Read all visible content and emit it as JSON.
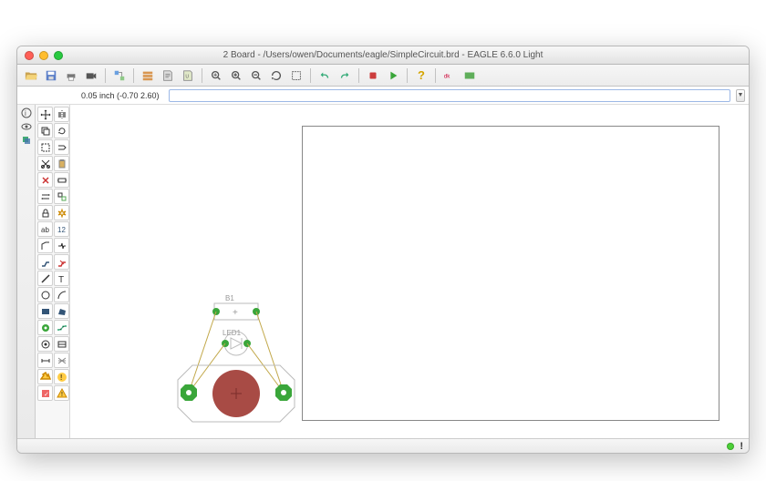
{
  "window": {
    "title": "2 Board - /Users/owen/Documents/eagle/SimpleCircuit.brd - EAGLE 6.6.0 Light"
  },
  "cmdrow": {
    "coord": "0.05 inch (-0.70 2.60)",
    "value": ""
  },
  "canvas": {
    "comp1_label": "B1",
    "comp2_label": "LED1",
    "plus": "+"
  },
  "status": {
    "excl": "!"
  },
  "toolbar": {
    "help": "?"
  },
  "colors": {
    "pad_green": "#3aa63a",
    "copper_red": "#a84b45",
    "airwire": "#c2a84a"
  }
}
